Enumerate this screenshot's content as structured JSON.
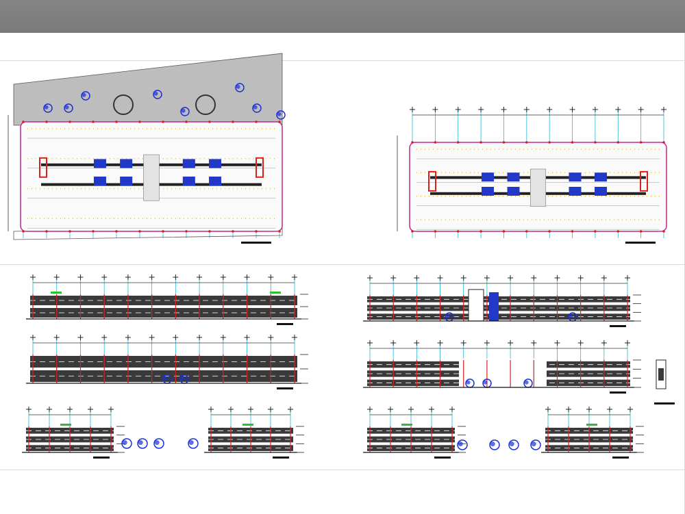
{
  "viewer": {
    "title": "",
    "background_color": "#ffffff",
    "toolbar_color": "#808080"
  },
  "drawing": {
    "layout": "parking-structure-sheet",
    "panels": [
      {
        "id": "site-plan",
        "kind": "plan",
        "label": ""
      },
      {
        "id": "typical-level-plan",
        "kind": "plan",
        "label": ""
      },
      {
        "id": "elevation-front",
        "kind": "elevation",
        "label": ""
      },
      {
        "id": "section-longitudinal",
        "kind": "section",
        "label": ""
      },
      {
        "id": "section-ramps",
        "kind": "section",
        "label": ""
      },
      {
        "id": "section-courtyard",
        "kind": "section",
        "label": ""
      },
      {
        "id": "elevation-side-pair",
        "kind": "elevation",
        "label": ""
      },
      {
        "id": "section-side-pair",
        "kind": "section",
        "label": ""
      },
      {
        "id": "detail-small",
        "kind": "detail",
        "label": ""
      }
    ],
    "colors": {
      "grid_line": "#22b8d8",
      "floor_band": "#3a3a3a",
      "parking_stripe": "#e8c23a",
      "outline_magenta": "#c0288f",
      "trees_blue": "#1a2fd6",
      "green_accent": "#2fbf2f",
      "red_columns": "#d92020",
      "site_gray": "#bdbdbd"
    }
  }
}
